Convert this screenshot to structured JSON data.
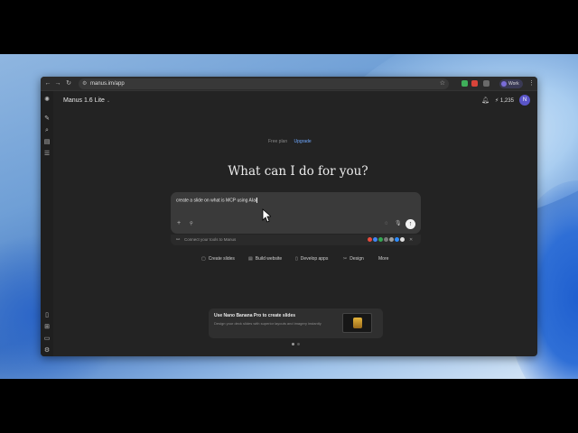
{
  "browser": {
    "url": "manus.im/app",
    "profile_initial": "N",
    "profile_name": "Work"
  },
  "app": {
    "title": "Manus 1.6 Lite",
    "credits": "1,235",
    "avatar_initial": "N"
  },
  "plan": {
    "free_label": "Free plan",
    "upgrade_label": "Upgrade"
  },
  "main": {
    "heading": "What can I do for you?"
  },
  "composer": {
    "input_value": "create a slide on what is MCP using AIai",
    "connect_label": "Connect your tools to Manus"
  },
  "quick_actions": [
    {
      "label": "Create slides",
      "icon": "slides-icon"
    },
    {
      "label": "Build website",
      "icon": "website-icon"
    },
    {
      "label": "Develop apps",
      "icon": "phone-icon"
    },
    {
      "label": "Design",
      "icon": "design-icon"
    },
    {
      "label": "More",
      "icon": ""
    }
  ],
  "promo": {
    "title": "Use Nano Banana Pro to create slides",
    "description": "Design your deck slides with superior layouts and imagery instantly"
  },
  "colors": {
    "accent": "#6ea8ff",
    "app_bg": "#232323",
    "composer_bg": "#3a3a3a",
    "avatar": "#5a55c8"
  }
}
